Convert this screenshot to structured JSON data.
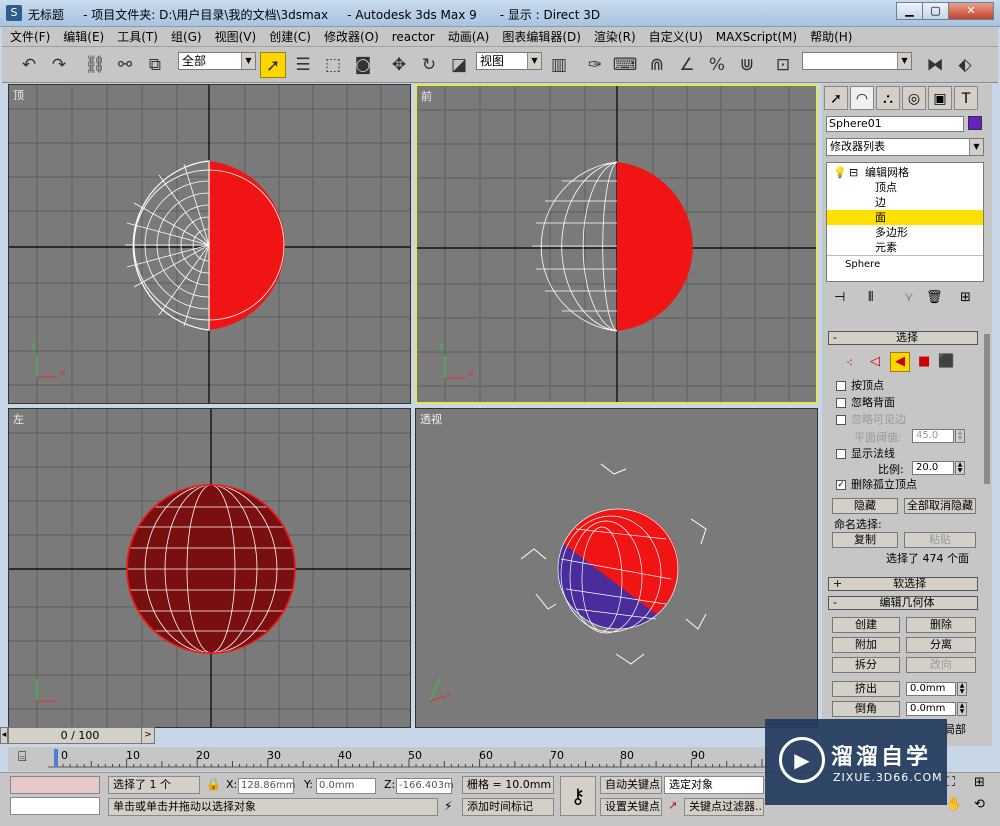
{
  "window": {
    "title": "无标题     - 项目文件夹: D:\\用户目录\\我的文档\\3dsmax     - Autodesk 3ds Max 9      - 显示 : Direct 3D",
    "app_icon": "3ds-max-icon"
  },
  "menu": [
    "文件(F)",
    "编辑(E)",
    "工具(T)",
    "组(G)",
    "视图(V)",
    "创建(C)",
    "修改器(O)",
    "reactor",
    "动画(A)",
    "图表编辑器(D)",
    "渲染(R)",
    "自定义(U)",
    "MAXScript(M)",
    "帮助(H)"
  ],
  "toolbar": {
    "selection_filter": "全部",
    "ref_coord": "视图",
    "named_selection": ""
  },
  "viewports": {
    "top": "顶",
    "front": "前",
    "left": "左",
    "persp": "透视"
  },
  "axes": {
    "x": "x",
    "y": "y",
    "z": "z"
  },
  "command_panel": {
    "object_name": "Sphere01",
    "modifier_list": "修改器列表",
    "stack": {
      "editable_mesh": "编辑网格",
      "vertex": "顶点",
      "edge": "边",
      "face": "面",
      "polygon": "多边形",
      "element": "元素",
      "base": "Sphere"
    },
    "selection_rollout": {
      "title": "选择",
      "by_vertex": "按顶点",
      "ignore_backfacing": "忽略背面",
      "ignore_visible_edges": "忽略可见边",
      "planar_threshold_label": "平面阈值:",
      "planar_threshold": "45.0",
      "show_normals": "显示法线",
      "scale_label": "比例:",
      "scale": "20.0",
      "delete_isolated": "删除孤立顶点",
      "hide": "隐藏",
      "unhide_all": "全部取消隐藏",
      "named_sel": "命名选择:",
      "copy": "复制",
      "paste": "粘贴",
      "status": "选择了 474 个面"
    },
    "soft_selection": "软选择",
    "edit_geometry": {
      "title": "编辑几何体",
      "create": "创建",
      "delete": "删除",
      "attach": "附加",
      "detach": "分离",
      "divide": "拆分",
      "turn": "改向",
      "extrude": "挤出",
      "extrude_val": "0.0mm",
      "bevel": "倒角",
      "bevel_val": "0.0mm",
      "partial": "局部"
    }
  },
  "timeline": {
    "slider": "0 / 100",
    "ticks": [
      "0",
      "10",
      "20",
      "30",
      "40",
      "50",
      "60",
      "70",
      "80",
      "90"
    ]
  },
  "status": {
    "selected": "选择了 1 个",
    "x_label": "X:",
    "x": "128.86mm",
    "y_label": "Y:",
    "y": "0.0mm",
    "z_label": "Z:",
    "z": "-166.403m",
    "grid": "栅格 = 10.0mm",
    "auto_key": "自动关键点",
    "set_key": "设置关键点",
    "key_mode": "选定对象",
    "key_filters": "关键点过滤器...",
    "prompt": "单击或单击并拖动以选择对象",
    "add_time_tag": "添加时间标记"
  },
  "watermark": {
    "brand": "溜溜自学",
    "url": "ZIXUE.3D66.COM"
  }
}
